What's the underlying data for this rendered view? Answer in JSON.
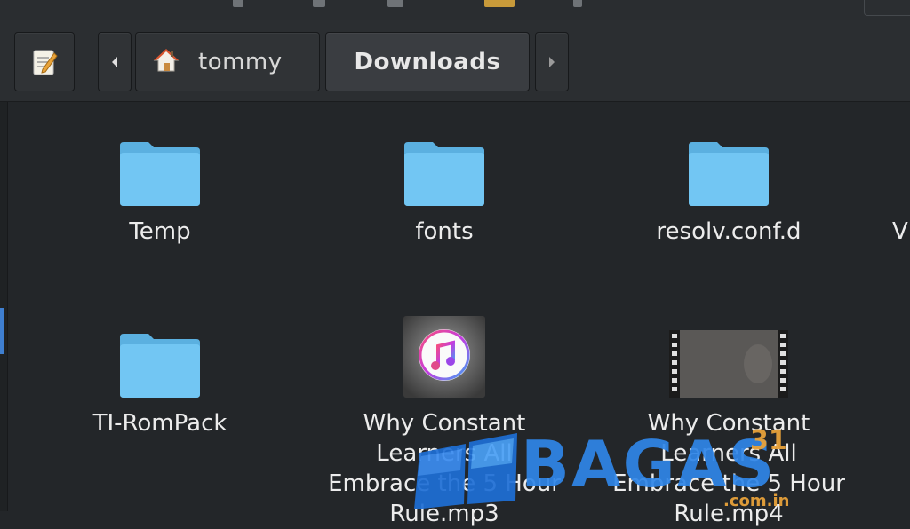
{
  "toolbar": {
    "breadcrumbs": [
      {
        "label": "tommy",
        "icon": "home-icon"
      },
      {
        "label": "Downloads"
      }
    ]
  },
  "files": [
    {
      "name": "Temp",
      "type": "folder"
    },
    {
      "name": "fonts",
      "type": "folder"
    },
    {
      "name": "resolv.conf.d",
      "type": "folder"
    },
    {
      "name": "V",
      "type": "folder"
    },
    {
      "name": "TI-RomPack",
      "type": "folder"
    },
    {
      "name": "Why Constant\nLearners All\nEmbrace the 5 Hour\nRule.mp3",
      "type": "audio"
    },
    {
      "name": "Why Constant\nLearners All\nEmbrace the 5 Hour\nRule.mp4",
      "type": "video"
    }
  ],
  "watermark": {
    "brand": "BAGAS",
    "superscript": "31",
    "domain": ".com.in"
  },
  "colors": {
    "folder": "#6ec3f0",
    "background": "#232629",
    "accent": "#3f7fd0"
  }
}
